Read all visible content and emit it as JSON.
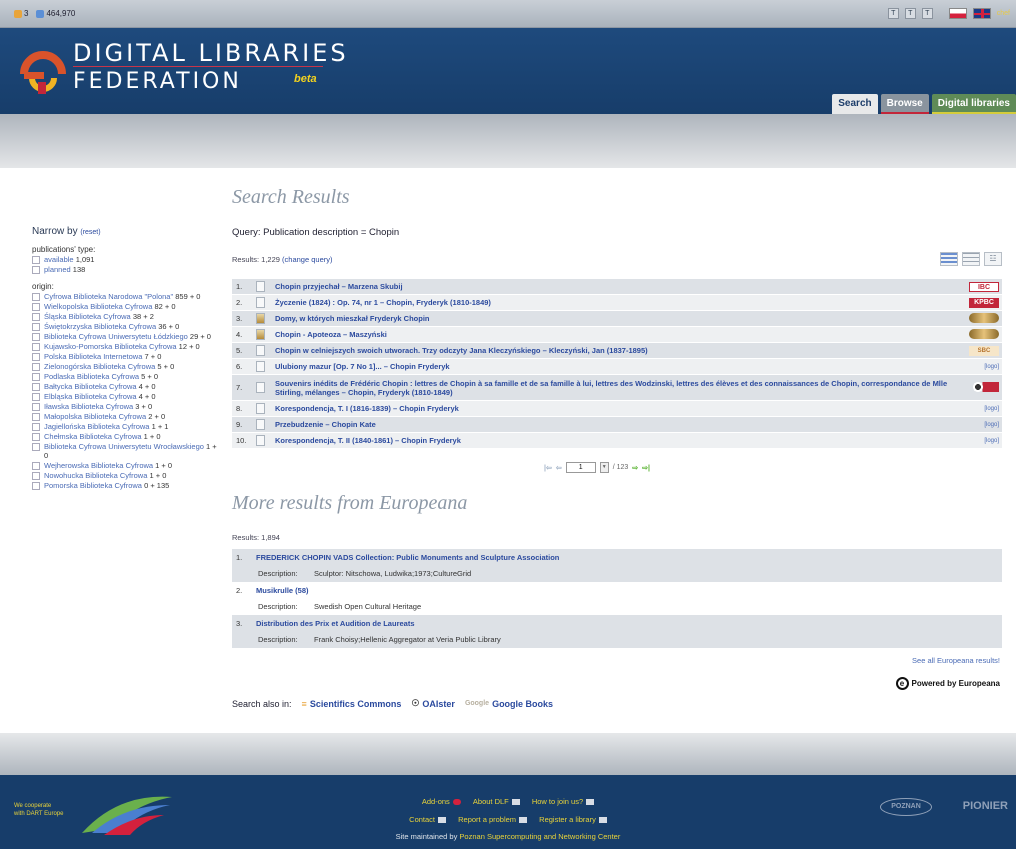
{
  "topbar": {
    "count1": "3",
    "count2": "464,970",
    "lang_text": "chef"
  },
  "header": {
    "title1": "DIGITAL LIBRARIES",
    "title2": "FEDERATION",
    "beta": "beta",
    "tabs": [
      {
        "label": "Search"
      },
      {
        "label": "Browse"
      },
      {
        "label": "Digital libraries"
      }
    ]
  },
  "sidebar": {
    "narrow_label": "Narrow by",
    "reset_label": "(reset)",
    "pubtype_label": "publications' type:",
    "pubtypes": [
      {
        "label": "available",
        "count": "1,091"
      },
      {
        "label": "planned",
        "count": "138"
      }
    ],
    "origin_label": "origin:",
    "origins": [
      {
        "label": "Cyfrowa Biblioteka Narodowa \"Polona\"",
        "count": "859 + 0"
      },
      {
        "label": "Wielkopolska Biblioteka Cyfrowa",
        "count": "82 + 0"
      },
      {
        "label": "Śląska Biblioteka Cyfrowa",
        "count": "38 + 2"
      },
      {
        "label": "Świętokrzyska Biblioteka Cyfrowa",
        "count": "36 + 0"
      },
      {
        "label": "Biblioteka Cyfrowa Uniwersytetu Łódzkiego",
        "count": "29 + 0"
      },
      {
        "label": "Kujawsko-Pomorska Biblioteka Cyfrowa",
        "count": "12 + 0"
      },
      {
        "label": "Polska Biblioteka Internetowa",
        "count": "7 + 0"
      },
      {
        "label": "Zielonogórska Biblioteka Cyfrowa",
        "count": "5 + 0"
      },
      {
        "label": "Podlaska Biblioteka Cyfrowa",
        "count": "5 + 0"
      },
      {
        "label": "Bałtycka Biblioteka Cyfrowa",
        "count": "4 + 0"
      },
      {
        "label": "Elbląska Biblioteka Cyfrowa",
        "count": "4 + 0"
      },
      {
        "label": "Iławska Biblioteka Cyfrowa",
        "count": "3 + 0"
      },
      {
        "label": "Małopolska Biblioteka Cyfrowa",
        "count": "2 + 0"
      },
      {
        "label": "Jagiellońska Biblioteka Cyfrowa",
        "count": "1 + 1"
      },
      {
        "label": "Chełmska Biblioteka Cyfrowa",
        "count": "1 + 0"
      },
      {
        "label": "Biblioteka Cyfrowa Uniwersytetu Wrocławskiego",
        "count": "1 + 0"
      },
      {
        "label": "Wejherowska Biblioteka Cyfrowa",
        "count": "1 + 0"
      },
      {
        "label": "Nowohucka Biblioteka Cyfrowa",
        "count": "1 + 0"
      },
      {
        "label": "Pomorska Biblioteka Cyfrowa",
        "count": "0 + 135"
      }
    ]
  },
  "main": {
    "heading": "Search Results",
    "query": "Query: Publication description = Chopin",
    "results_prefix": "Results: 1,229",
    "change_query": "(change query)",
    "results": [
      {
        "num": "1.",
        "title": "Chopin przyjechał – Marzena Skubij",
        "logo": "IBC",
        "img": false
      },
      {
        "num": "2.",
        "title": "Życzenie (1824) : Op. 74, nr 1 – Chopin, Fryderyk (1810-1849)",
        "logo": "KPBC",
        "img": false
      },
      {
        "num": "3.",
        "title": "Domy, w których mieszkał Fryderyk Chopin",
        "logo": "",
        "img": true
      },
      {
        "num": "4.",
        "title": "Chopin - Apoteoza – Maszyński",
        "logo": "",
        "img": true
      },
      {
        "num": "5.",
        "title": "Chopin w celniejszych swoich utworach. Trzy odczyty Jana Kleczyńskiego – Kleczyński, Jan (1837-1895)",
        "logo": "SBC",
        "img": false
      },
      {
        "num": "6.",
        "title": "Ulubiony mazur [Op. 7 No 1]... – Chopin Fryderyk",
        "logo": "[logo]",
        "img": false
      },
      {
        "num": "7.",
        "title": "Souvenirs inédits de Frédéric Chopin : lettres de Chopin à sa famille et de sa famille à lui, lettres des Wodzinski, lettres des élèves et des connaissances de Chopin, correspondance de Mlle Stirling, mélanges – Chopin, Fryderyk (1810-1849)",
        "logo": "",
        "img": false
      },
      {
        "num": "8.",
        "title": "Korespondencja, T. I (1816-1839) – Chopin Fryderyk",
        "logo": "[logo]",
        "img": false
      },
      {
        "num": "9.",
        "title": "Przebudzenie – Chopin Kate",
        "logo": "[logo]",
        "img": false
      },
      {
        "num": "10.",
        "title": "Korespondencja, T. II (1840-1861) – Chopin Fryderyk",
        "logo": "[logo]",
        "img": false
      }
    ],
    "pager": {
      "page": "1",
      "total": "/ 123"
    }
  },
  "europeana": {
    "heading": "More results from Europeana",
    "count": "Results: 1,894",
    "desc_label": "Description:",
    "items": [
      {
        "num": "1.",
        "title": "FREDERICK CHOPIN VADS Collection: Public Monuments and Sculpture Association",
        "desc": "Sculptor: Nitschowa, Ludwika;1973;CultureGrid"
      },
      {
        "num": "2.",
        "title": "Musikrulle (58)",
        "desc": "Swedish Open Cultural Heritage"
      },
      {
        "num": "3.",
        "title": "Distribution des Prix et Audition de Laureats",
        "desc": "Frank Choisy;Hellenic Aggregator at Veria Public Library"
      }
    ],
    "see_all": "See all Europeana results!",
    "powered": "Powered by Europeana"
  },
  "search_also": {
    "label": "Search also in:",
    "links": [
      "Scientifics Commons",
      "OAIster",
      "Google Books"
    ]
  },
  "footer": {
    "coop1": "We cooperate",
    "coop2": "with DART Europe",
    "addons": "Add-ons",
    "about": "About DLF",
    "join": "How to join us?",
    "contact": "Contact",
    "report": "Report a problem",
    "register": "Register a library",
    "maintained_prefix": "Site maintained by",
    "maintainer": "Poznan Supercomputing and Networking Center",
    "poznan": "POZNAN",
    "pionier": "PIONIER"
  },
  "colors": {
    "header_bg": "#1e4a7d",
    "link": "#2b4a9e",
    "footer_link": "#e8d33a",
    "browse_tab": "#8a949e",
    "digital_tab": "#5f8b57"
  }
}
